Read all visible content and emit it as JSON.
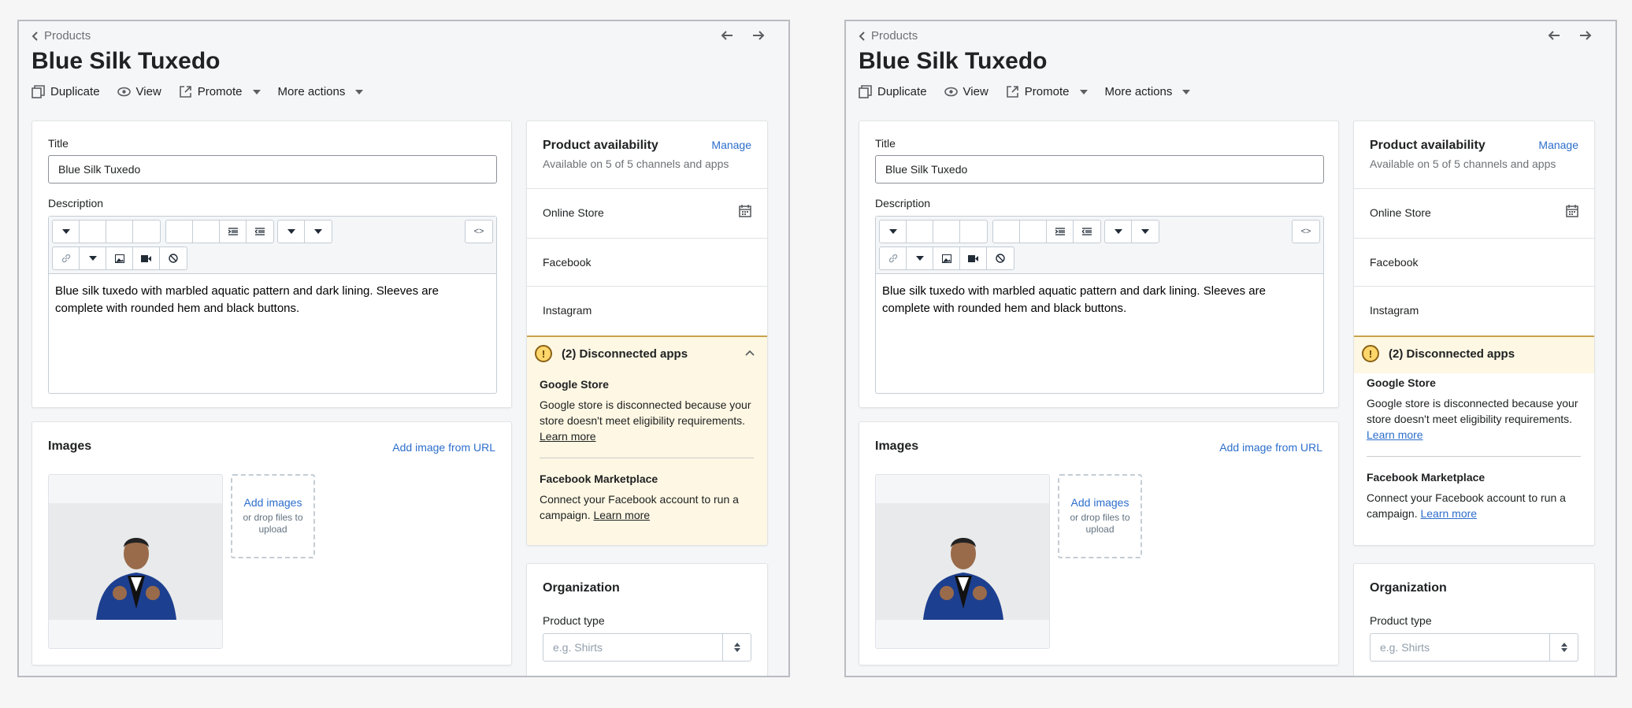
{
  "breadcrumb": "Products",
  "title": "Blue Silk Tuxedo",
  "actions": {
    "duplicate": "Duplicate",
    "view": "View",
    "promote": "Promote",
    "more": "More actions"
  },
  "form": {
    "title_label": "Title",
    "title_value": "Blue Silk Tuxedo",
    "description_label": "Description",
    "description_value": "Blue silk tuxedo with marbled aquatic pattern and dark lining. Sleeves are complete with rounded hem and black buttons.",
    "html_button": "<>"
  },
  "images": {
    "title": "Images",
    "add_url": "Add image from URL",
    "add_images": "Add images",
    "drop_hint": "or drop files to upload"
  },
  "availability": {
    "title": "Product availability",
    "manage": "Manage",
    "subtitle": "Available on 5 of 5 channels and apps",
    "channels": [
      "Online Store",
      "Facebook",
      "Instagram"
    ],
    "disconnected_title": "(2) Disconnected apps",
    "warn_glyph": "!",
    "apps": [
      {
        "name": "Google Store",
        "desc": "Google store is disconnected because your store doesn't meet eligibility requirements.",
        "link": "Learn more"
      },
      {
        "name": "Facebook Marketplace",
        "desc": "Connect your Facebook account to run a campaign.",
        "link": "Learn more"
      }
    ]
  },
  "organization": {
    "title": "Organization",
    "product_type_label": "Product type",
    "product_type_placeholder": "e.g. Shirts"
  },
  "colors": {
    "link": "#2c6ecb",
    "warning_bg": "#fdf7e3",
    "warning_icon": "#ffd66b"
  }
}
